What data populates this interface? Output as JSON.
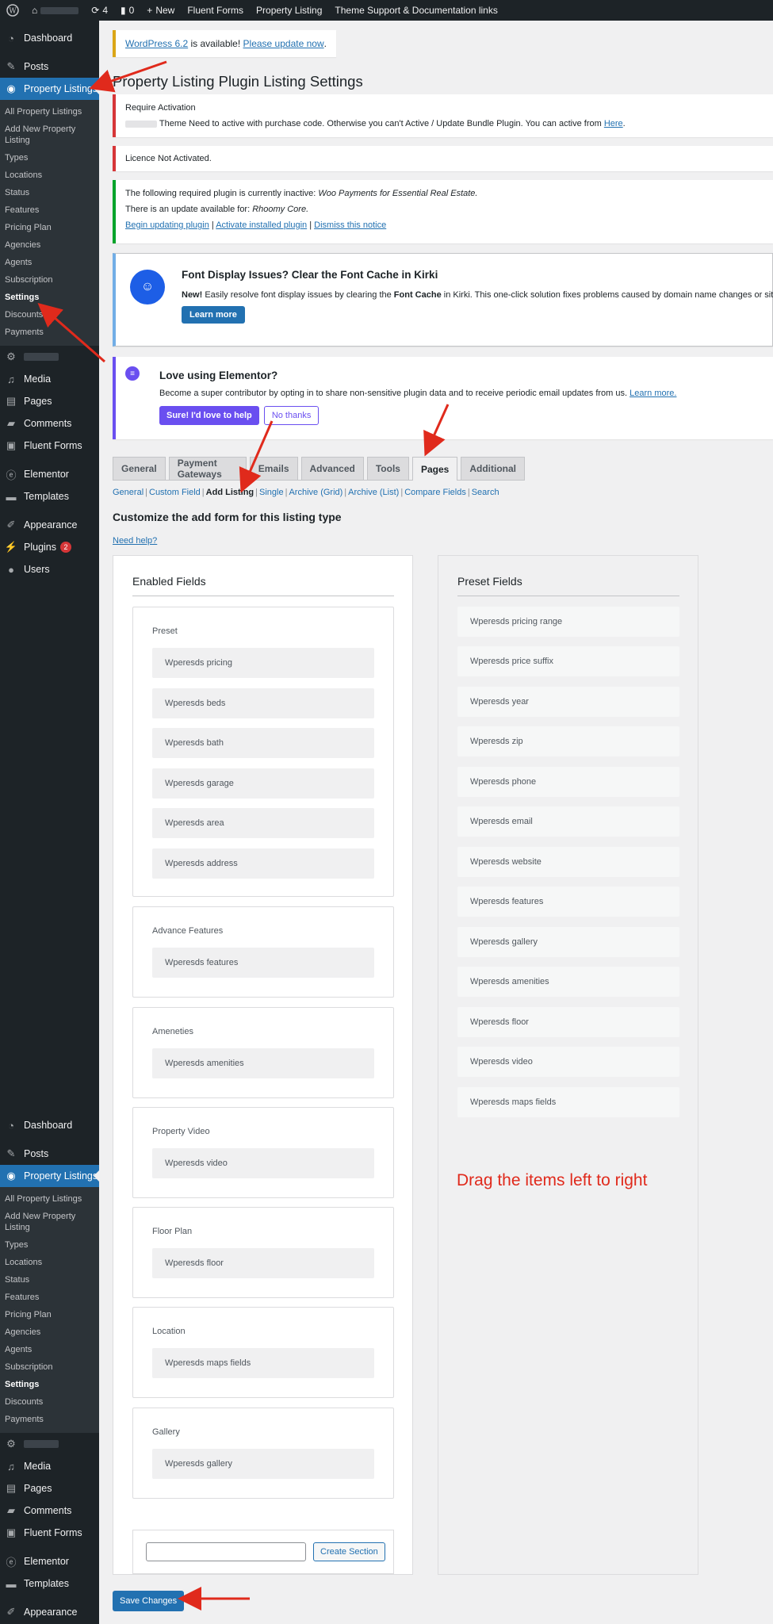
{
  "adminbar": {
    "updates_count": "4",
    "comments_count": "0",
    "new_label": "New",
    "links": [
      "Fluent Forms",
      "Property Listing",
      "Theme Support & Documentation links"
    ]
  },
  "sidebar_top": {
    "dashboard": "Dashboard",
    "posts": "Posts",
    "property_listings": "Property Listings",
    "submenu": [
      "All Property Listings",
      "Add New Property Listing",
      "Types",
      "Locations",
      "Status",
      "Features",
      "Pricing Plan",
      "Agencies",
      "Agents",
      "Subscription",
      "Settings",
      "Discounts",
      "Payments"
    ],
    "media": "Media",
    "pages": "Pages",
    "comments": "Comments",
    "fluent_forms": "Fluent Forms",
    "elementor": "Elementor",
    "templates": "Templates",
    "appearance": "Appearance",
    "plugins": "Plugins",
    "plugins_badge": "2",
    "users": "Users"
  },
  "sidebar_bottom": {
    "dashboard": "Dashboard",
    "posts": "Posts",
    "property_listings": "Property Listings",
    "submenu": [
      "All Property Listings",
      "Add New Property Listing",
      "Types",
      "Locations",
      "Status",
      "Features",
      "Pricing Plan",
      "Agencies",
      "Agents",
      "Subscription",
      "Settings",
      "Discounts",
      "Payments"
    ],
    "media": "Media",
    "pages": "Pages",
    "comments": "Comments",
    "fluent_forms": "Fluent Forms",
    "elementor": "Elementor",
    "templates": "Templates",
    "appearance": "Appearance"
  },
  "update_nag": {
    "link": "WordPress 6.2",
    "text": " is available! ",
    "action": "Please update now",
    "end": "."
  },
  "page_title": "Property Listing Plugin Listing Settings",
  "notices": {
    "activation_title": "Require Activation",
    "activation_text": "Theme Need to active with purchase code. Otherwise you can't Active / Update Bundle Plugin. You can active from ",
    "activation_link": "Here",
    "licence": "Licence Not Activated.",
    "plugin_line1_prefix": "The following required plugin is currently inactive: ",
    "plugin_line1_name": "Woo Payments for Essential Real Estate.",
    "plugin_line2_prefix": "There is an update available for: ",
    "plugin_line2_name": "Rhoomy Core.",
    "plugin_actions": [
      "Begin updating plugin",
      "Activate installed plugin",
      "Dismiss this notice"
    ],
    "kirki_title": "Font Display Issues? Clear the Font Cache in Kirki",
    "kirki_new": "New!",
    "kirki_text": " Easily resolve font display issues by clearing the ",
    "kirki_bold": "Font Cache",
    "kirki_text2": " in Kirki. This one-click solution fixes problems caused by domain name changes or site migrations",
    "kirki_button": "Learn more",
    "elementor_title": "Love using Elementor?",
    "elementor_text": "Become a super contributor by opting in to share non-sensitive plugin data and to receive periodic email updates from us. ",
    "elementor_link": "Learn more.",
    "elementor_yes": "Sure! I'd love to help",
    "elementor_no": "No thanks"
  },
  "tabs": [
    "General",
    "Payment Gateways",
    "Emails",
    "Advanced",
    "Tools",
    "Pages",
    "Additional"
  ],
  "active_tab": "Pages",
  "subnav": [
    "General",
    "Custom Field",
    "Add Listing",
    "Single",
    "Archive (Grid)",
    "Archive (List)",
    "Compare Fields",
    "Search"
  ],
  "section_title": "Customize the add form for this listing type",
  "help_link": "Need help?",
  "enabled": {
    "heading": "Enabled Fields",
    "groups": [
      {
        "label": "Preset",
        "fields": [
          "Wperesds pricing",
          "Wperesds beds",
          "Wperesds bath",
          "Wperesds garage",
          "Wperesds area",
          "Wperesds address"
        ]
      },
      {
        "label": "Advance Features",
        "fields": [
          "Wperesds features"
        ]
      },
      {
        "label": "Ameneties",
        "fields": [
          "Wperesds amenities"
        ]
      },
      {
        "label": "Property Video",
        "fields": [
          "Wperesds video"
        ]
      },
      {
        "label": "Floor Plan",
        "fields": [
          "Wperesds floor"
        ]
      },
      {
        "label": "Location",
        "fields": [
          "Wperesds maps fields"
        ]
      },
      {
        "label": "Gallery",
        "fields": [
          "Wperesds gallery"
        ]
      }
    ],
    "create_button": "Create Section"
  },
  "preset": {
    "heading": "Preset Fields",
    "fields": [
      "Wperesds pricing range",
      "Wperesds price suffix",
      "Wperesds year",
      "Wperesds zip",
      "Wperesds phone",
      "Wperesds email",
      "Wperesds website",
      "Wperesds features",
      "Wperesds gallery",
      "Wperesds amenities",
      "Wperesds floor",
      "Wperesds video",
      "Wperesds maps fields"
    ]
  },
  "drag_note": "Drag the items left to right",
  "save_button": "Save Changes",
  "colors": {
    "admin_dark": "#1d2327",
    "accent": "#2271b1",
    "annotation_red": "#e02a1c",
    "elementor": "#6a4ff0"
  }
}
